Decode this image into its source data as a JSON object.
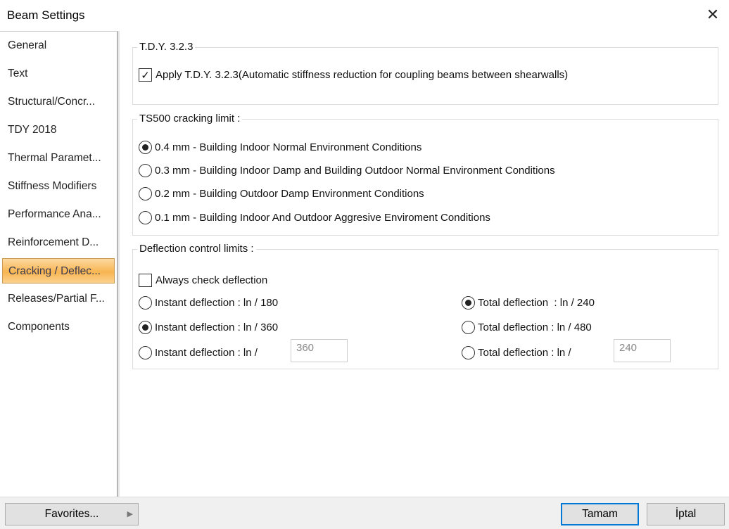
{
  "window": {
    "title": "Beam Settings",
    "close_icon": "close-icon"
  },
  "sidebar": {
    "items": [
      {
        "label": "General"
      },
      {
        "label": "Text"
      },
      {
        "label": "Structural/Concr..."
      },
      {
        "label": "TDY 2018"
      },
      {
        "label": "Thermal Paramet..."
      },
      {
        "label": "Stiffness Modifiers"
      },
      {
        "label": "Performance Ana..."
      },
      {
        "label": "Reinforcement D..."
      },
      {
        "label": "Cracking / Deflec...",
        "selected": true
      },
      {
        "label": "Releases/Partial F..."
      },
      {
        "label": "Components"
      }
    ]
  },
  "tdy": {
    "legend": "T.D.Y. 3.2.3",
    "apply_label": "Apply T.D.Y. 3.2.3(Automatic stiffness reduction for coupling beams between shearwalls)",
    "apply_checked": true
  },
  "cracking": {
    "legend": "TS500 cracking limit :",
    "options": [
      {
        "label": "0.4 mm - Building Indoor Normal Environment Conditions",
        "selected": true
      },
      {
        "label": "0.3 mm - Building Indoor Damp and Building Outdoor Normal Environment Conditions",
        "selected": false
      },
      {
        "label": "0.2 mm - Building Outdoor Damp Environment Conditions",
        "selected": false
      },
      {
        "label": "0.1 mm - Building Indoor And Outdoor Aggresive Enviroment Conditions",
        "selected": false
      }
    ]
  },
  "deflection": {
    "legend": "Deflection control limits :",
    "always_label": "Always check deflection",
    "always_checked": false,
    "instant": [
      {
        "label": "Instant deflection : ln / 180",
        "selected": false
      },
      {
        "label": "Instant deflection : ln / 360",
        "selected": true
      },
      {
        "label": "Instant deflection : ln /",
        "selected": false
      }
    ],
    "instant_custom": "360",
    "total": [
      {
        "label": "Total deflection  : ln / 240",
        "selected": true
      },
      {
        "label": "Total deflection : ln / 480",
        "selected": false
      },
      {
        "label": "Total deflection : ln /",
        "selected": false
      }
    ],
    "total_custom": "240"
  },
  "footer": {
    "favorites": "Favorites...",
    "ok": "Tamam",
    "cancel": "İptal"
  }
}
